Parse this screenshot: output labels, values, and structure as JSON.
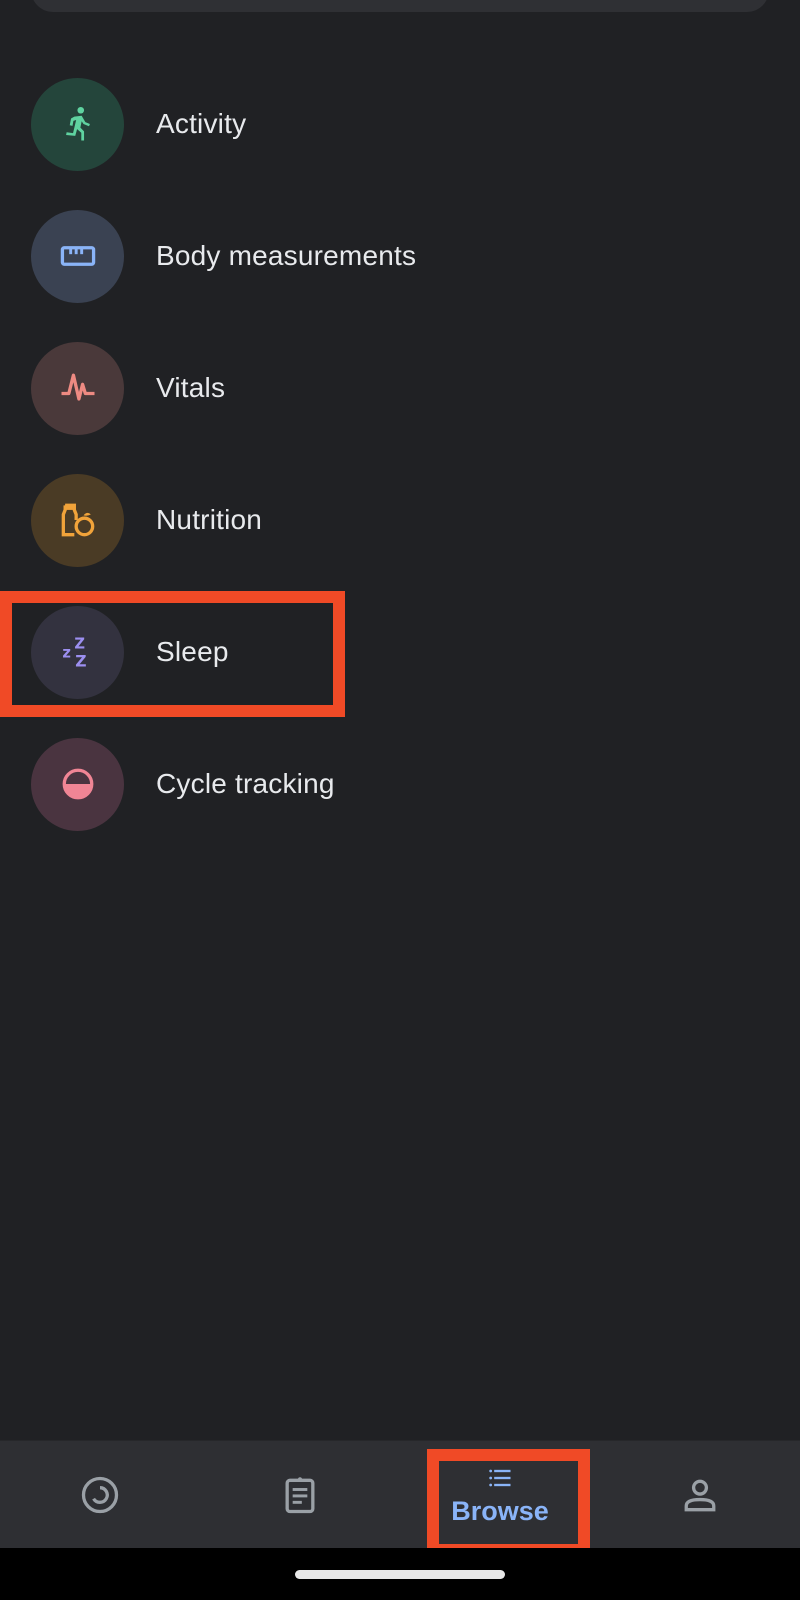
{
  "categories": [
    {
      "label": "Activity",
      "icon": "running-person-icon",
      "icon_color": "#5fd3a0",
      "bg_color": "#24453b"
    },
    {
      "label": "Body measurements",
      "icon": "ruler-icon",
      "icon_color": "#8ab4f8",
      "bg_color": "#3a4252"
    },
    {
      "label": "Vitals",
      "icon": "heartbeat-icon",
      "icon_color": "#ee8a82",
      "bg_color": "#4a393a"
    },
    {
      "label": "Nutrition",
      "icon": "food-icon",
      "icon_color": "#f1a33a",
      "bg_color": "#4a3b25"
    },
    {
      "label": "Sleep",
      "icon": "zzz-icon",
      "icon_color": "#9c8ff0",
      "bg_color": "#33323f"
    },
    {
      "label": "Cycle tracking",
      "icon": "half-circle-icon",
      "icon_color": "#f08595",
      "bg_color": "#4a3440"
    }
  ],
  "highlight_color": "#f04a26",
  "bottom_nav": {
    "items": [
      {
        "name": "today",
        "icon": "ring-progress-icon",
        "label": ""
      },
      {
        "name": "summary",
        "icon": "clipboard-icon",
        "label": ""
      },
      {
        "name": "browse",
        "icon": "list-icon",
        "label": "Browse",
        "active": true
      },
      {
        "name": "profile",
        "icon": "person-icon",
        "label": ""
      }
    ],
    "active_color": "#8ab4f8",
    "inactive_color": "#9aa0a6"
  }
}
